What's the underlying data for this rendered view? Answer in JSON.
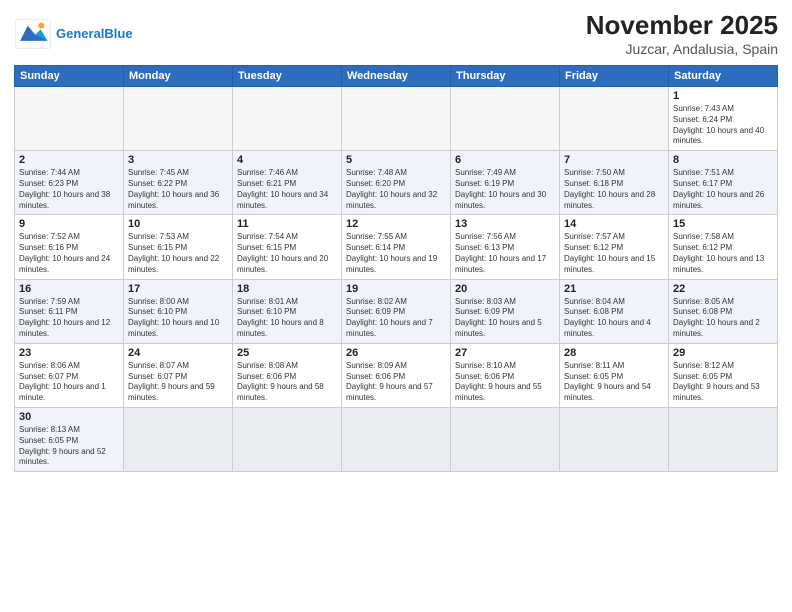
{
  "header": {
    "logo": {
      "general": "General",
      "blue": "Blue"
    },
    "title": "November 2025",
    "subtitle": "Juzcar, Andalusia, Spain"
  },
  "weekdays": [
    "Sunday",
    "Monday",
    "Tuesday",
    "Wednesday",
    "Thursday",
    "Friday",
    "Saturday"
  ],
  "days": [
    {
      "day": "",
      "empty": true
    },
    {
      "day": "",
      "empty": true
    },
    {
      "day": "",
      "empty": true
    },
    {
      "day": "",
      "empty": true
    },
    {
      "day": "",
      "empty": true
    },
    {
      "day": "",
      "empty": true
    },
    {
      "day": "1",
      "sunrise": "Sunrise: 7:43 AM",
      "sunset": "Sunset: 6:24 PM",
      "daylight": "Daylight: 10 hours and 40 minutes."
    },
    {
      "day": "2",
      "sunrise": "Sunrise: 7:44 AM",
      "sunset": "Sunset: 6:23 PM",
      "daylight": "Daylight: 10 hours and 38 minutes."
    },
    {
      "day": "3",
      "sunrise": "Sunrise: 7:45 AM",
      "sunset": "Sunset: 6:22 PM",
      "daylight": "Daylight: 10 hours and 36 minutes."
    },
    {
      "day": "4",
      "sunrise": "Sunrise: 7:46 AM",
      "sunset": "Sunset: 6:21 PM",
      "daylight": "Daylight: 10 hours and 34 minutes."
    },
    {
      "day": "5",
      "sunrise": "Sunrise: 7:48 AM",
      "sunset": "Sunset: 6:20 PM",
      "daylight": "Daylight: 10 hours and 32 minutes."
    },
    {
      "day": "6",
      "sunrise": "Sunrise: 7:49 AM",
      "sunset": "Sunset: 6:19 PM",
      "daylight": "Daylight: 10 hours and 30 minutes."
    },
    {
      "day": "7",
      "sunrise": "Sunrise: 7:50 AM",
      "sunset": "Sunset: 6:18 PM",
      "daylight": "Daylight: 10 hours and 28 minutes."
    },
    {
      "day": "8",
      "sunrise": "Sunrise: 7:51 AM",
      "sunset": "Sunset: 6:17 PM",
      "daylight": "Daylight: 10 hours and 26 minutes."
    },
    {
      "day": "9",
      "sunrise": "Sunrise: 7:52 AM",
      "sunset": "Sunset: 6:16 PM",
      "daylight": "Daylight: 10 hours and 24 minutes."
    },
    {
      "day": "10",
      "sunrise": "Sunrise: 7:53 AM",
      "sunset": "Sunset: 6:15 PM",
      "daylight": "Daylight: 10 hours and 22 minutes."
    },
    {
      "day": "11",
      "sunrise": "Sunrise: 7:54 AM",
      "sunset": "Sunset: 6:15 PM",
      "daylight": "Daylight: 10 hours and 20 minutes."
    },
    {
      "day": "12",
      "sunrise": "Sunrise: 7:55 AM",
      "sunset": "Sunset: 6:14 PM",
      "daylight": "Daylight: 10 hours and 19 minutes."
    },
    {
      "day": "13",
      "sunrise": "Sunrise: 7:56 AM",
      "sunset": "Sunset: 6:13 PM",
      "daylight": "Daylight: 10 hours and 17 minutes."
    },
    {
      "day": "14",
      "sunrise": "Sunrise: 7:57 AM",
      "sunset": "Sunset: 6:12 PM",
      "daylight": "Daylight: 10 hours and 15 minutes."
    },
    {
      "day": "15",
      "sunrise": "Sunrise: 7:58 AM",
      "sunset": "Sunset: 6:12 PM",
      "daylight": "Daylight: 10 hours and 13 minutes."
    },
    {
      "day": "16",
      "sunrise": "Sunrise: 7:59 AM",
      "sunset": "Sunset: 6:11 PM",
      "daylight": "Daylight: 10 hours and 12 minutes."
    },
    {
      "day": "17",
      "sunrise": "Sunrise: 8:00 AM",
      "sunset": "Sunset: 6:10 PM",
      "daylight": "Daylight: 10 hours and 10 minutes."
    },
    {
      "day": "18",
      "sunrise": "Sunrise: 8:01 AM",
      "sunset": "Sunset: 6:10 PM",
      "daylight": "Daylight: 10 hours and 8 minutes."
    },
    {
      "day": "19",
      "sunrise": "Sunrise: 8:02 AM",
      "sunset": "Sunset: 6:09 PM",
      "daylight": "Daylight: 10 hours and 7 minutes."
    },
    {
      "day": "20",
      "sunrise": "Sunrise: 8:03 AM",
      "sunset": "Sunset: 6:09 PM",
      "daylight": "Daylight: 10 hours and 5 minutes."
    },
    {
      "day": "21",
      "sunrise": "Sunrise: 8:04 AM",
      "sunset": "Sunset: 6:08 PM",
      "daylight": "Daylight: 10 hours and 4 minutes."
    },
    {
      "day": "22",
      "sunrise": "Sunrise: 8:05 AM",
      "sunset": "Sunset: 6:08 PM",
      "daylight": "Daylight: 10 hours and 2 minutes."
    },
    {
      "day": "23",
      "sunrise": "Sunrise: 8:06 AM",
      "sunset": "Sunset: 6:07 PM",
      "daylight": "Daylight: 10 hours and 1 minute."
    },
    {
      "day": "24",
      "sunrise": "Sunrise: 8:07 AM",
      "sunset": "Sunset: 6:07 PM",
      "daylight": "Daylight: 9 hours and 59 minutes."
    },
    {
      "day": "25",
      "sunrise": "Sunrise: 8:08 AM",
      "sunset": "Sunset: 6:06 PM",
      "daylight": "Daylight: 9 hours and 58 minutes."
    },
    {
      "day": "26",
      "sunrise": "Sunrise: 8:09 AM",
      "sunset": "Sunset: 6:06 PM",
      "daylight": "Daylight: 9 hours and 57 minutes."
    },
    {
      "day": "27",
      "sunrise": "Sunrise: 8:10 AM",
      "sunset": "Sunset: 6:06 PM",
      "daylight": "Daylight: 9 hours and 55 minutes."
    },
    {
      "day": "28",
      "sunrise": "Sunrise: 8:11 AM",
      "sunset": "Sunset: 6:05 PM",
      "daylight": "Daylight: 9 hours and 54 minutes."
    },
    {
      "day": "29",
      "sunrise": "Sunrise: 8:12 AM",
      "sunset": "Sunset: 6:05 PM",
      "daylight": "Daylight: 9 hours and 53 minutes."
    },
    {
      "day": "30",
      "sunrise": "Sunrise: 8:13 AM",
      "sunset": "Sunset: 6:05 PM",
      "daylight": "Daylight: 9 hours and 52 minutes."
    }
  ]
}
